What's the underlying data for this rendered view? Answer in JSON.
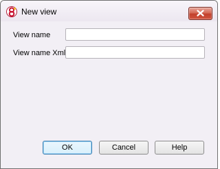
{
  "window": {
    "title": "New view"
  },
  "icons": {
    "app": "app-logo-icon",
    "close": "close-icon"
  },
  "form": {
    "view_name": {
      "label": "View name",
      "value": "",
      "placeholder": ""
    },
    "view_name_xml": {
      "label": "View name Xml",
      "value": "",
      "placeholder": ""
    }
  },
  "buttons": {
    "ok": "OK",
    "cancel": "Cancel",
    "help": "Help"
  },
  "colors": {
    "close_button": "#c2412d",
    "default_button_border": "#3c7fb1",
    "window_bg": "#f2eff5"
  }
}
